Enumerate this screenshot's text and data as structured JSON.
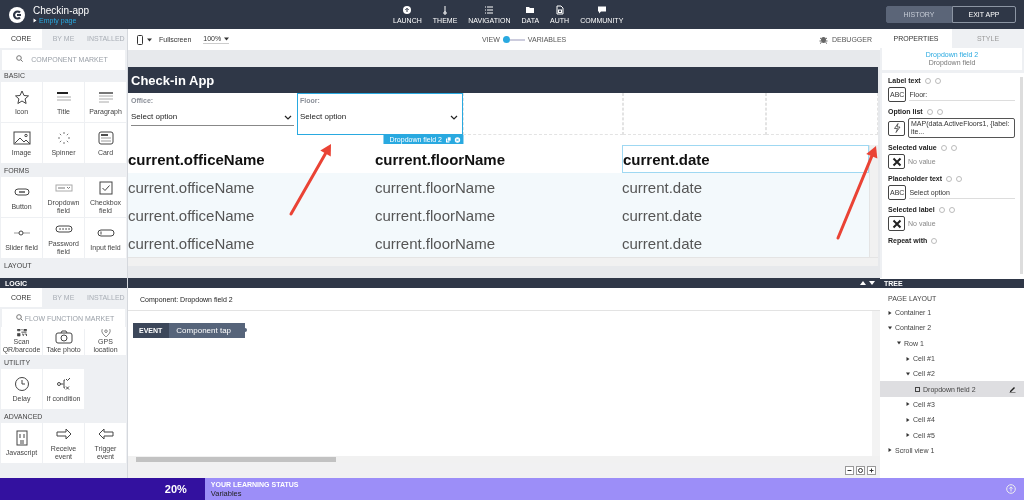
{
  "top_bar": {
    "app_name": "Checkin-app",
    "page": "Empty page",
    "nav": [
      "LAUNCH",
      "THEME",
      "NAVIGATION",
      "DATA",
      "AUTH",
      "COMMUNITY"
    ],
    "buttons": [
      {
        "label": "HISTORY",
        "kind": "filled"
      },
      {
        "label": "EXIT APP",
        "kind": "outline"
      }
    ]
  },
  "components_panel": {
    "tabs": [
      {
        "label": "CORE",
        "selected": true
      },
      {
        "label": "BY ME",
        "selected": false
      },
      {
        "label": "INSTALLED",
        "selected": false
      }
    ],
    "search": {
      "placeholder": "COMPONENT MARKET"
    },
    "groups": [
      {
        "title": "BASIC",
        "items": [
          "Icon",
          "Title",
          "Paragraph",
          "Image",
          "Spinner",
          "Card"
        ]
      },
      {
        "title": "FORMS",
        "items": [
          "Button",
          "Dropdown field",
          "Checkbox field",
          "Slider field",
          "Password field",
          "Input field"
        ]
      },
      {
        "title": "LAYOUT"
      }
    ]
  },
  "logic_panel": {
    "title": "LOGIC",
    "tabs": [
      {
        "label": "CORE",
        "selected": true
      },
      {
        "label": "BY ME",
        "selected": false
      },
      {
        "label": "INSTALLED",
        "selected": false
      }
    ],
    "search": {
      "placeholder": "FLOW FUNCTION MARKET"
    },
    "groups": [
      {
        "items": [
          "Scan QR/barcode",
          "Take photo",
          "GPS location"
        ]
      },
      {
        "title": "UTILITY",
        "items": [
          "Delay",
          "If condition"
        ]
      },
      {
        "title": "ADVANCED",
        "items": [
          "Javascript",
          "Receive event",
          "Trigger event"
        ]
      }
    ]
  },
  "toolbar": {
    "device": "Fullscreen",
    "zoom": "100%",
    "toggle": {
      "left_label": "VIEW",
      "right_label": "VARIABLES",
      "on": false
    },
    "debugger": "DEBUGGER"
  },
  "preview": {
    "title": "Check-in App",
    "dropdowns": [
      {
        "label": "Office:",
        "placeholder": "Select option",
        "selected": false
      },
      {
        "label": "Floor:",
        "placeholder": "Select option",
        "selected": true,
        "tag": "Dropdown field 2"
      }
    ],
    "rows": [
      {
        "kind": "header",
        "cells": [
          {
            "text": "current.officeName",
            "selected": false
          },
          {
            "text": "current.floorName",
            "selected": false
          },
          {
            "text": "current.date",
            "selected": true
          }
        ]
      },
      {
        "kind": "item",
        "cells": [
          {
            "text": "current.officeName",
            "selected": false
          },
          {
            "text": "current.floorName",
            "selected": false
          },
          {
            "text": "current.date",
            "selected": false
          }
        ]
      },
      {
        "kind": "item",
        "cells": [
          {
            "text": "current.officeName",
            "selected": false
          },
          {
            "text": "current.floorName",
            "selected": false
          },
          {
            "text": "current.date",
            "selected": false
          }
        ]
      },
      {
        "kind": "item",
        "cells": [
          {
            "text": "current.officeName",
            "selected": false
          },
          {
            "text": "current.floorName",
            "selected": false
          },
          {
            "text": "current.date",
            "selected": false
          }
        ]
      }
    ]
  },
  "flow_editor": {
    "component": "Component: Dropdown field 2",
    "blocks": [
      {
        "type": "EVENT",
        "name": "Component tap"
      }
    ]
  },
  "properties_panel": {
    "tabs": [
      {
        "label": "PROPERTIES",
        "selected": true
      },
      {
        "label": "STYLE",
        "selected": false
      }
    ],
    "component_name": "Dropdown field 2",
    "component_type": "Dropdown field",
    "properties": [
      {
        "label": "Label text",
        "kind": "text",
        "badge": "ABC",
        "value": "Floor:"
      },
      {
        "label": "Option list",
        "kind": "formula",
        "value": "MAP(data.ActiveFloors1, {label: ite..."
      },
      {
        "label": "Selected value",
        "kind": "empty",
        "value": "No value"
      },
      {
        "label": "Placeholder text",
        "kind": "text",
        "badge": "ABC",
        "value": "Select option"
      },
      {
        "label": "Selected label",
        "kind": "empty",
        "value": "No value"
      },
      {
        "label": "Repeat with",
        "kind": "heading"
      }
    ]
  },
  "tree": {
    "title": "TREE",
    "heading": "PAGE LAYOUT",
    "items": [
      {
        "label": "Container 1",
        "expanded": false,
        "selected": false
      },
      {
        "label": "Container 2",
        "expanded": true,
        "selected": false,
        "children": [
          {
            "label": "Row 1",
            "expanded": true,
            "selected": false,
            "children": [
              {
                "label": "Cell #1",
                "expanded": false,
                "selected": false
              },
              {
                "label": "Cell #2",
                "expanded": true,
                "selected": false,
                "children": [
                  {
                    "label": "Dropdown field 2",
                    "selected": true
                  }
                ]
              },
              {
                "label": "Cell #3",
                "expanded": false,
                "selected": false
              },
              {
                "label": "Cell #4",
                "expanded": false,
                "selected": false
              },
              {
                "label": "Cell #5",
                "expanded": false,
                "selected": false
              }
            ]
          }
        ]
      },
      {
        "label": "Scroll view 1",
        "expanded": false,
        "selected": false
      }
    ]
  },
  "status_bar": {
    "level": 0.2,
    "percent": "20%",
    "caption": "YOUR LEARNING STATUS",
    "lesson": "Variables"
  }
}
